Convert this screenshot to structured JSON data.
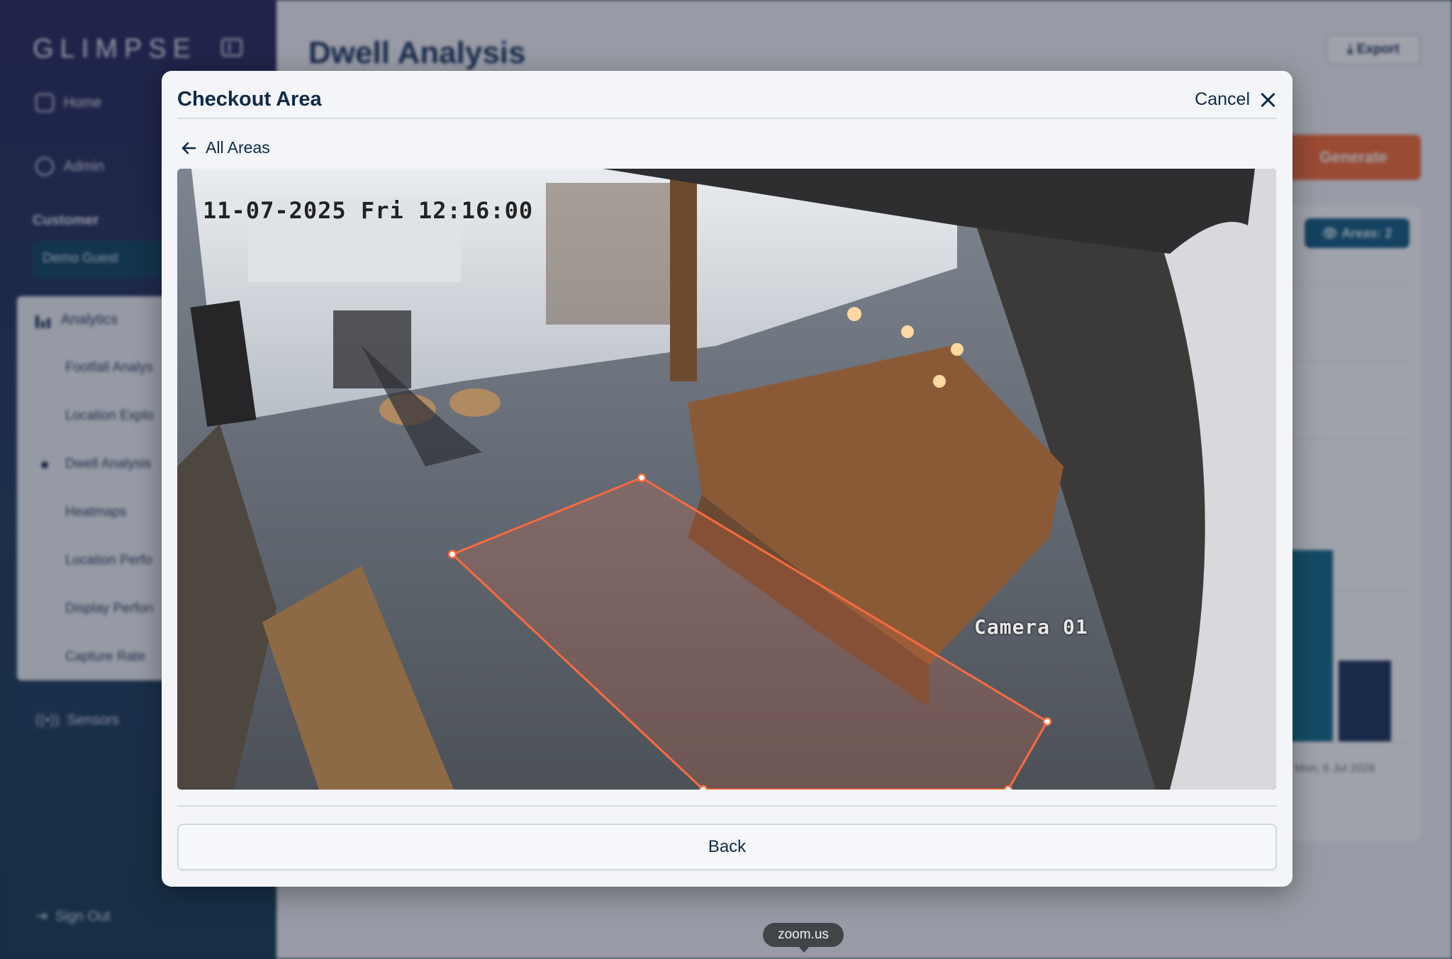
{
  "app": {
    "brand": "GLIMPSE"
  },
  "sidebar": {
    "home_label": "Home",
    "admin_label": "Admin",
    "customer_label": "Customer",
    "customer_value": "Demo Guest",
    "analytics_label": "Analytics",
    "sub_items": [
      {
        "label": "Footfall Analys"
      },
      {
        "label": "Location Explo"
      },
      {
        "label": "Dwell Analysis",
        "active": true
      },
      {
        "label": "Heatmaps"
      },
      {
        "label": "Location Perfo"
      },
      {
        "label": "Display Perforı"
      },
      {
        "label": "Capture Rate"
      }
    ],
    "sensors_label": "Sensors",
    "signout_label": "Sign Out"
  },
  "main": {
    "title": "Dwell Analysis",
    "export_label": "Export",
    "generate_label": "Generate",
    "areas_badge": "Areas: 2",
    "chart_date": "Mon, 6 Jul 2026"
  },
  "modal": {
    "title": "Checkout Area",
    "cancel_label": "Cancel",
    "back_link_label": "All Areas",
    "camera": {
      "timestamp": "11-07-2025 Fri 12:16:00",
      "label": "Camera 01",
      "zone_color": "#ff6a3d"
    },
    "footer_button": "Back"
  },
  "tooltip": {
    "text": "zoom.us"
  },
  "colors": {
    "accent": "#f46a35",
    "brand_dark": "#0f2a47",
    "badge": "#0e5a80"
  }
}
